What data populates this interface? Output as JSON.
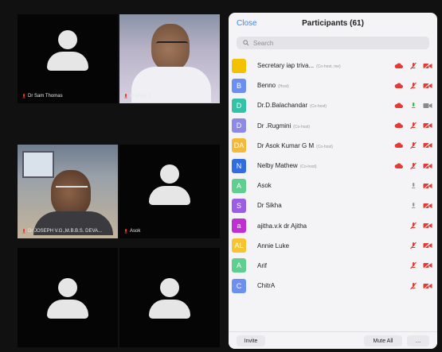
{
  "tiles": [
    {
      "name": "Dr Sam Thomas"
    },
    {
      "name": "Prathap C"
    },
    {
      "name": "Dr JOSEPH V.G.,M.B.B.S. DEVA..."
    },
    {
      "name": "Asok"
    },
    {
      "name": ""
    },
    {
      "name": ""
    }
  ],
  "panel": {
    "close_label": "Close",
    "title": "Participants (61)",
    "search_placeholder": "Search",
    "participants": [
      {
        "initial": "",
        "color": "#f2c200",
        "name": "Secretary iap triva...",
        "role": "(Co-host, me)",
        "cloud": true,
        "mic": "muted",
        "video": "off"
      },
      {
        "initial": "B",
        "color": "#6c8ff2",
        "name": "Benno",
        "role": "(Host)",
        "cloud": true,
        "mic": "muted",
        "video": "off"
      },
      {
        "initial": "D",
        "color": "#33c1a8",
        "name": "Dr.D.Balachandar",
        "role": "(Co-host)",
        "cloud": true,
        "mic": "on",
        "video": "on"
      },
      {
        "initial": "D",
        "color": "#8c8ae6",
        "name": "Dr .Rugmini",
        "role": "(Co-host)",
        "cloud": true,
        "mic": "muted",
        "video": "off"
      },
      {
        "initial": "DA",
        "color": "#f5b93a",
        "name": "Dr Asok Kumar G M",
        "role": "(Co-host)",
        "cloud": true,
        "mic": "muted",
        "video": "off"
      },
      {
        "initial": "N",
        "color": "#2f6de0",
        "name": "Nelby Mathew",
        "role": "(Co-host)",
        "cloud": true,
        "mic": "muted",
        "video": "off"
      },
      {
        "initial": "A",
        "color": "#5fcf8f",
        "name": "Asok",
        "role": "",
        "cloud": false,
        "mic": "gray",
        "video": "off"
      },
      {
        "initial": "S",
        "color": "#9b5de5",
        "name": "Dr Sikha",
        "role": "",
        "cloud": false,
        "mic": "gray",
        "video": "off"
      },
      {
        "initial": "a",
        "color": "#c02fd2",
        "name": "ajitha.v.k dr Ajitha",
        "role": "",
        "cloud": false,
        "mic": "muted",
        "video": "off"
      },
      {
        "initial": "AL",
        "color": "#f5c430",
        "name": "Annie Luke",
        "role": "",
        "cloud": false,
        "mic": "muted",
        "video": "off"
      },
      {
        "initial": "A",
        "color": "#5fcf8f",
        "name": "Arif",
        "role": "",
        "cloud": false,
        "mic": "muted",
        "video": "off"
      },
      {
        "initial": "C",
        "color": "#6c8ff2",
        "name": "ChitrA",
        "role": "",
        "cloud": false,
        "mic": "muted",
        "video": "off"
      }
    ],
    "invite_label": "Invite",
    "mute_all_label": "Mute All",
    "more_label": "…"
  }
}
